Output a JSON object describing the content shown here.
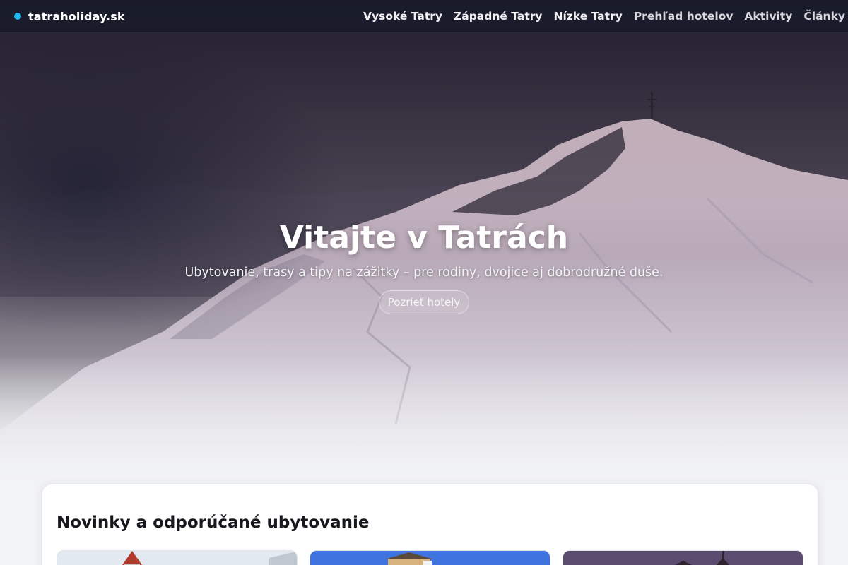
{
  "site": {
    "brand": "tatraholiday.sk",
    "brand_color": "#22b8f0"
  },
  "nav": {
    "items": [
      {
        "label": "Vysoké Tatry"
      },
      {
        "label": "Západné Tatry"
      },
      {
        "label": "Nízke Tatry"
      },
      {
        "label": "Prehľad hotelov"
      },
      {
        "label": "Aktivity"
      },
      {
        "label": "Články"
      }
    ]
  },
  "hero": {
    "title": "Vitajte v Tatrách",
    "subtitle": "Ubytovanie, trasy a tipy na zážitky – pre rodiny, dvojice aj dobrodružné duše.",
    "cta": "Pozrieť hotely"
  },
  "featured": {
    "title": "Novinky a odporúčané ubytovanie",
    "cards": [
      {
        "image": "hotel-photo-1"
      },
      {
        "image": "hotel-photo-2"
      },
      {
        "image": "hotel-photo-3"
      }
    ]
  }
}
